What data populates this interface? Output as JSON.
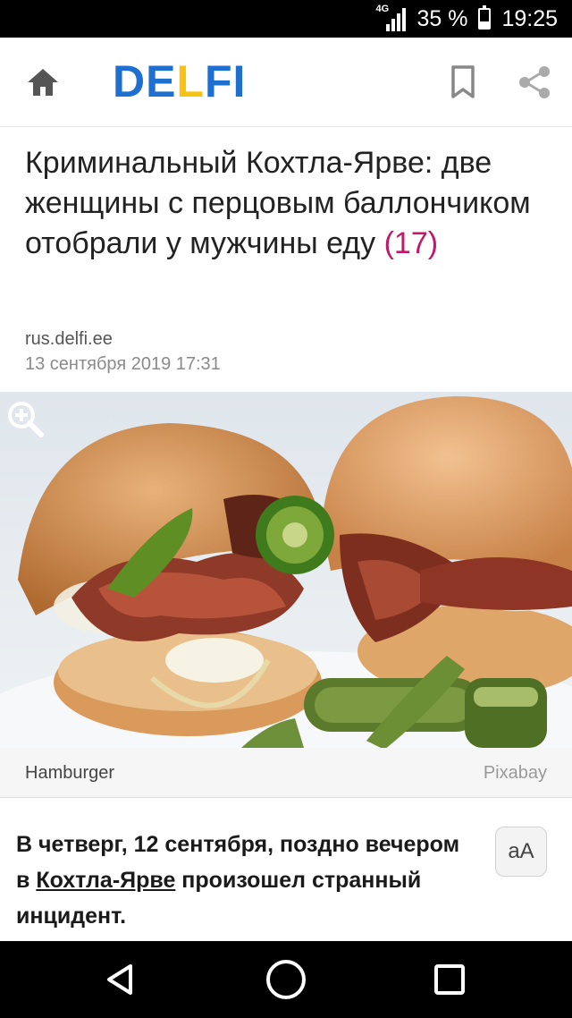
{
  "status_bar": {
    "network": "4G",
    "battery_percent": "35 %",
    "battery_level": 0.35,
    "time": "19:25"
  },
  "header": {
    "logo_text_1": "DE",
    "logo_text_2": "L",
    "logo_text_3": "FI",
    "logo_colors": {
      "blue": "#1f6fd1",
      "yellow": "#f8c212"
    },
    "icons": [
      "home-icon",
      "bookmark-icon",
      "share-icon"
    ]
  },
  "article": {
    "headline": "Криминальный Кохтла-Ярве: две женщины с перцовым баллончиком отобрали у мужчины еду",
    "comment_count": "(17)",
    "source": "rus.delfi.ee",
    "date": "13 сентября 2019 17:31",
    "image_caption": "Hamburger",
    "image_credit": "Pixabay",
    "body_part1": "В четверг, 12 сентября, поздно вечером в ",
    "body_link": "Кохтла-Ярве",
    "body_part2": " произошел странный инцидент.",
    "font_size_button": "aA"
  },
  "nav_bar": {
    "icons": [
      "back-icon",
      "home-circle-icon",
      "recent-apps-icon"
    ]
  },
  "colors": {
    "accent_comment": "#c0196a",
    "status_bar_bg": "#000000"
  }
}
